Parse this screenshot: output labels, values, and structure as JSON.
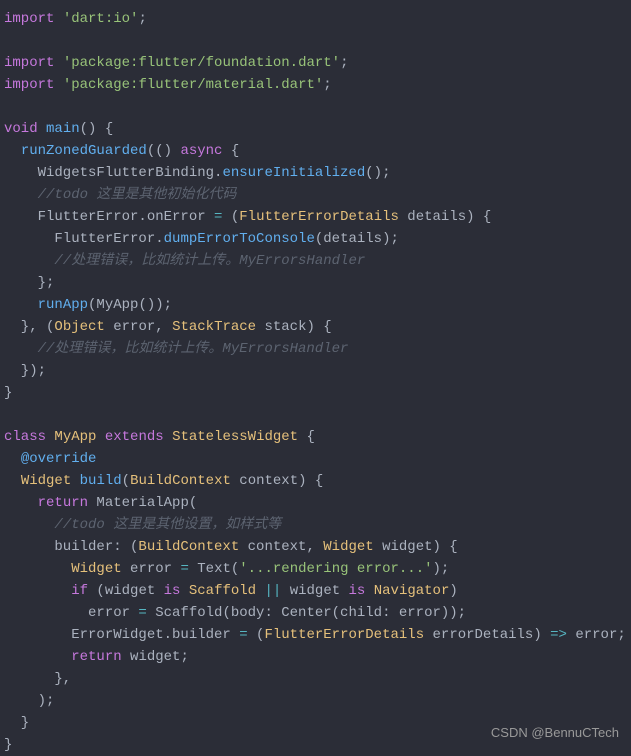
{
  "code": {
    "lines": [
      [
        {
          "cls": "kw",
          "t": "import"
        },
        {
          "cls": "plain",
          "t": " "
        },
        {
          "cls": "str",
          "t": "'dart:io'"
        },
        {
          "cls": "pun",
          "t": ";"
        }
      ],
      [],
      [
        {
          "cls": "kw",
          "t": "import"
        },
        {
          "cls": "plain",
          "t": " "
        },
        {
          "cls": "str",
          "t": "'package:flutter/foundation.dart'"
        },
        {
          "cls": "pun",
          "t": ";"
        }
      ],
      [
        {
          "cls": "kw",
          "t": "import"
        },
        {
          "cls": "plain",
          "t": " "
        },
        {
          "cls": "str",
          "t": "'package:flutter/material.dart'"
        },
        {
          "cls": "pun",
          "t": ";"
        }
      ],
      [],
      [
        {
          "cls": "kw",
          "t": "void"
        },
        {
          "cls": "plain",
          "t": " "
        },
        {
          "cls": "fn",
          "t": "main"
        },
        {
          "cls": "pun",
          "t": "() {"
        }
      ],
      [
        {
          "cls": "plain",
          "t": "  "
        },
        {
          "cls": "fn",
          "t": "runZonedGuarded"
        },
        {
          "cls": "pun",
          "t": "(() "
        },
        {
          "cls": "kw",
          "t": "async"
        },
        {
          "cls": "pun",
          "t": " {"
        }
      ],
      [
        {
          "cls": "plain",
          "t": "    WidgetsFlutterBinding."
        },
        {
          "cls": "fn",
          "t": "ensureInitialized"
        },
        {
          "cls": "pun",
          "t": "();"
        }
      ],
      [
        {
          "cls": "plain",
          "t": "    "
        },
        {
          "cls": "cmt",
          "t": "//todo 这里是其他初始化代码"
        }
      ],
      [
        {
          "cls": "plain",
          "t": "    FlutterError.onError "
        },
        {
          "cls": "op",
          "t": "="
        },
        {
          "cls": "plain",
          "t": " ("
        },
        {
          "cls": "cls",
          "t": "FlutterErrorDetails"
        },
        {
          "cls": "plain",
          "t": " details) {"
        }
      ],
      [
        {
          "cls": "plain",
          "t": "      FlutterError."
        },
        {
          "cls": "fn",
          "t": "dumpErrorToConsole"
        },
        {
          "cls": "pun",
          "t": "(details);"
        }
      ],
      [
        {
          "cls": "plain",
          "t": "      "
        },
        {
          "cls": "cmt",
          "t": "//处理错误，比如统计上传。MyErrorsHandler"
        }
      ],
      [
        {
          "cls": "pun",
          "t": "    };"
        }
      ],
      [
        {
          "cls": "plain",
          "t": "    "
        },
        {
          "cls": "fn",
          "t": "runApp"
        },
        {
          "cls": "pun",
          "t": "(MyApp());"
        }
      ],
      [
        {
          "cls": "pun",
          "t": "  }, ("
        },
        {
          "cls": "cls",
          "t": "Object"
        },
        {
          "cls": "plain",
          "t": " error, "
        },
        {
          "cls": "cls",
          "t": "StackTrace"
        },
        {
          "cls": "plain",
          "t": " stack) {"
        }
      ],
      [
        {
          "cls": "plain",
          "t": "    "
        },
        {
          "cls": "cmt",
          "t": "//处理错误，比如统计上传。MyErrorsHandler"
        }
      ],
      [
        {
          "cls": "pun",
          "t": "  });"
        }
      ],
      [
        {
          "cls": "pun",
          "t": "}"
        }
      ],
      [],
      [
        {
          "cls": "kw",
          "t": "class"
        },
        {
          "cls": "plain",
          "t": " "
        },
        {
          "cls": "cls",
          "t": "MyApp"
        },
        {
          "cls": "plain",
          "t": " "
        },
        {
          "cls": "kw",
          "t": "extends"
        },
        {
          "cls": "plain",
          "t": " "
        },
        {
          "cls": "cls",
          "t": "StatelessWidget"
        },
        {
          "cls": "plain",
          "t": " {"
        }
      ],
      [
        {
          "cls": "plain",
          "t": "  "
        },
        {
          "cls": "dec",
          "t": "@override"
        }
      ],
      [
        {
          "cls": "plain",
          "t": "  "
        },
        {
          "cls": "cls",
          "t": "Widget"
        },
        {
          "cls": "plain",
          "t": " "
        },
        {
          "cls": "fn",
          "t": "build"
        },
        {
          "cls": "pun",
          "t": "("
        },
        {
          "cls": "cls",
          "t": "BuildContext"
        },
        {
          "cls": "plain",
          "t": " context) {"
        }
      ],
      [
        {
          "cls": "plain",
          "t": "    "
        },
        {
          "cls": "kw",
          "t": "return"
        },
        {
          "cls": "plain",
          "t": " MaterialApp("
        }
      ],
      [
        {
          "cls": "plain",
          "t": "      "
        },
        {
          "cls": "cmt",
          "t": "//todo 这里是其他设置，如样式等"
        }
      ],
      [
        {
          "cls": "plain",
          "t": "      builder: ("
        },
        {
          "cls": "cls",
          "t": "BuildContext"
        },
        {
          "cls": "plain",
          "t": " context, "
        },
        {
          "cls": "cls",
          "t": "Widget"
        },
        {
          "cls": "plain",
          "t": " widget) {"
        }
      ],
      [
        {
          "cls": "plain",
          "t": "        "
        },
        {
          "cls": "cls",
          "t": "Widget"
        },
        {
          "cls": "plain",
          "t": " error "
        },
        {
          "cls": "op",
          "t": "="
        },
        {
          "cls": "plain",
          "t": " Text("
        },
        {
          "cls": "str",
          "t": "'...rendering error...'"
        },
        {
          "cls": "pun",
          "t": ");"
        }
      ],
      [
        {
          "cls": "plain",
          "t": "        "
        },
        {
          "cls": "kw",
          "t": "if"
        },
        {
          "cls": "plain",
          "t": " (widget "
        },
        {
          "cls": "kw",
          "t": "is"
        },
        {
          "cls": "plain",
          "t": " "
        },
        {
          "cls": "cls",
          "t": "Scaffold"
        },
        {
          "cls": "plain",
          "t": " "
        },
        {
          "cls": "op",
          "t": "||"
        },
        {
          "cls": "plain",
          "t": " widget "
        },
        {
          "cls": "kw",
          "t": "is"
        },
        {
          "cls": "plain",
          "t": " "
        },
        {
          "cls": "cls",
          "t": "Navigator"
        },
        {
          "cls": "pun",
          "t": ")"
        }
      ],
      [
        {
          "cls": "plain",
          "t": "          error "
        },
        {
          "cls": "op",
          "t": "="
        },
        {
          "cls": "plain",
          "t": " Scaffold(body: Center(child: error));"
        }
      ],
      [
        {
          "cls": "plain",
          "t": "        ErrorWidget.builder "
        },
        {
          "cls": "op",
          "t": "="
        },
        {
          "cls": "plain",
          "t": " ("
        },
        {
          "cls": "cls",
          "t": "FlutterErrorDetails"
        },
        {
          "cls": "plain",
          "t": " errorDetails) "
        },
        {
          "cls": "op",
          "t": "=>"
        },
        {
          "cls": "plain",
          "t": " error;"
        }
      ],
      [
        {
          "cls": "plain",
          "t": "        "
        },
        {
          "cls": "kw",
          "t": "return"
        },
        {
          "cls": "plain",
          "t": " widget;"
        }
      ],
      [
        {
          "cls": "pun",
          "t": "      },"
        }
      ],
      [
        {
          "cls": "pun",
          "t": "    );"
        }
      ],
      [
        {
          "cls": "pun",
          "t": "  }"
        }
      ],
      [
        {
          "cls": "pun",
          "t": "}"
        }
      ]
    ]
  },
  "watermark": "CSDN @BennuCTech"
}
